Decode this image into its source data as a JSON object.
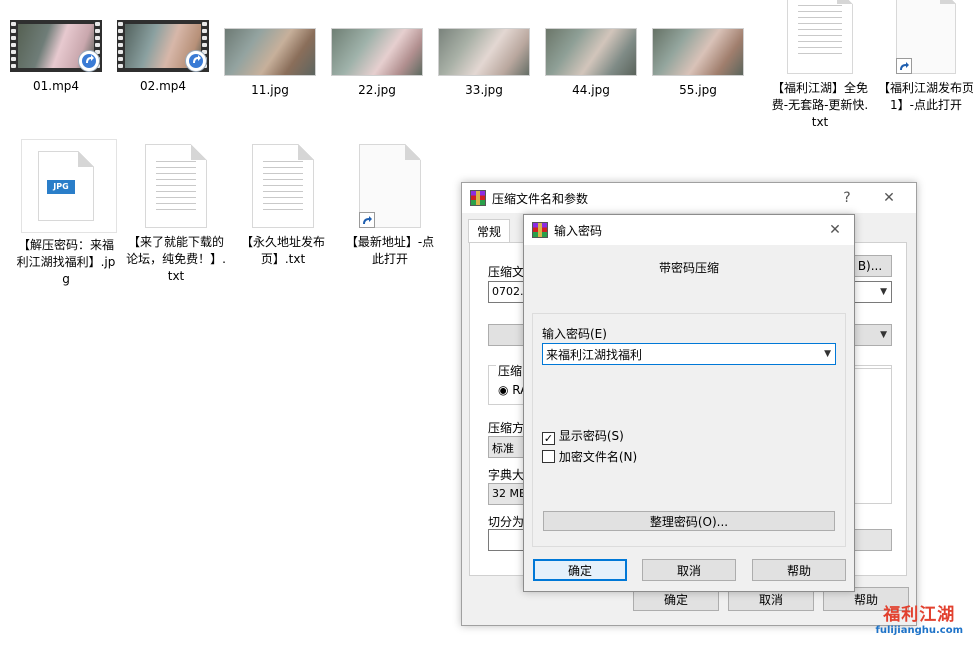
{
  "files_row1": [
    {
      "name": "01.mp4",
      "kind": "video"
    },
    {
      "name": "02.mp4",
      "kind": "video"
    },
    {
      "name": "11.jpg",
      "kind": "image"
    },
    {
      "name": "22.jpg",
      "kind": "image"
    },
    {
      "name": "33.jpg",
      "kind": "image"
    },
    {
      "name": "44.jpg",
      "kind": "image"
    },
    {
      "name": "55.jpg",
      "kind": "image"
    },
    {
      "name": "【福利江湖】全免费-无套路-更新快.txt",
      "kind": "text"
    },
    {
      "name": "【福利江湖发布页1】-点此打开",
      "kind": "shortcut"
    }
  ],
  "files_row2": [
    {
      "name": "【解压密码：来福利江湖找福利】.jpg",
      "kind": "jpg",
      "badge": "JPG"
    },
    {
      "name": "【来了就能下载的论坛，纯免费！】.txt",
      "kind": "text"
    },
    {
      "name": "【永久地址发布页】.txt",
      "kind": "text"
    },
    {
      "name": "【最新地址】-点此打开",
      "kind": "shortcut"
    }
  ],
  "back_dialog": {
    "title": "压缩文件名和参数",
    "help_glyph": "?",
    "close_glyph": "✕",
    "tab_general": "常规",
    "archive_name_label": "压缩文",
    "browse_label": "B)...",
    "archive_name_value": "0702.r",
    "format_group_label": "压缩",
    "format_radio_label": "RA",
    "method_label": "压缩方",
    "method_value": "标准",
    "dict_label": "字典大",
    "dict_value": "32 MB",
    "split_label": "切分为",
    "ok": "确定",
    "cancel": "取消",
    "help": "帮助"
  },
  "password_dialog": {
    "title": "输入密码",
    "close_glyph": "✕",
    "heading": "带密码压缩",
    "password_label": "输入密码(E)",
    "password_value": "来福利江湖找福利",
    "show_password_label": "显示密码(S)",
    "show_password_checked": true,
    "encrypt_names_label": "加密文件名(N)",
    "encrypt_names_checked": false,
    "organize_button": "整理密码(O)...",
    "ok": "确定",
    "cancel": "取消",
    "help": "帮助"
  },
  "watermark": {
    "brand": "福利江湖",
    "url": "fulijianghu.com"
  },
  "colors": {
    "accent": "#0078d7",
    "watermark_red": "#e2412f",
    "watermark_blue": "#1e73c8"
  }
}
